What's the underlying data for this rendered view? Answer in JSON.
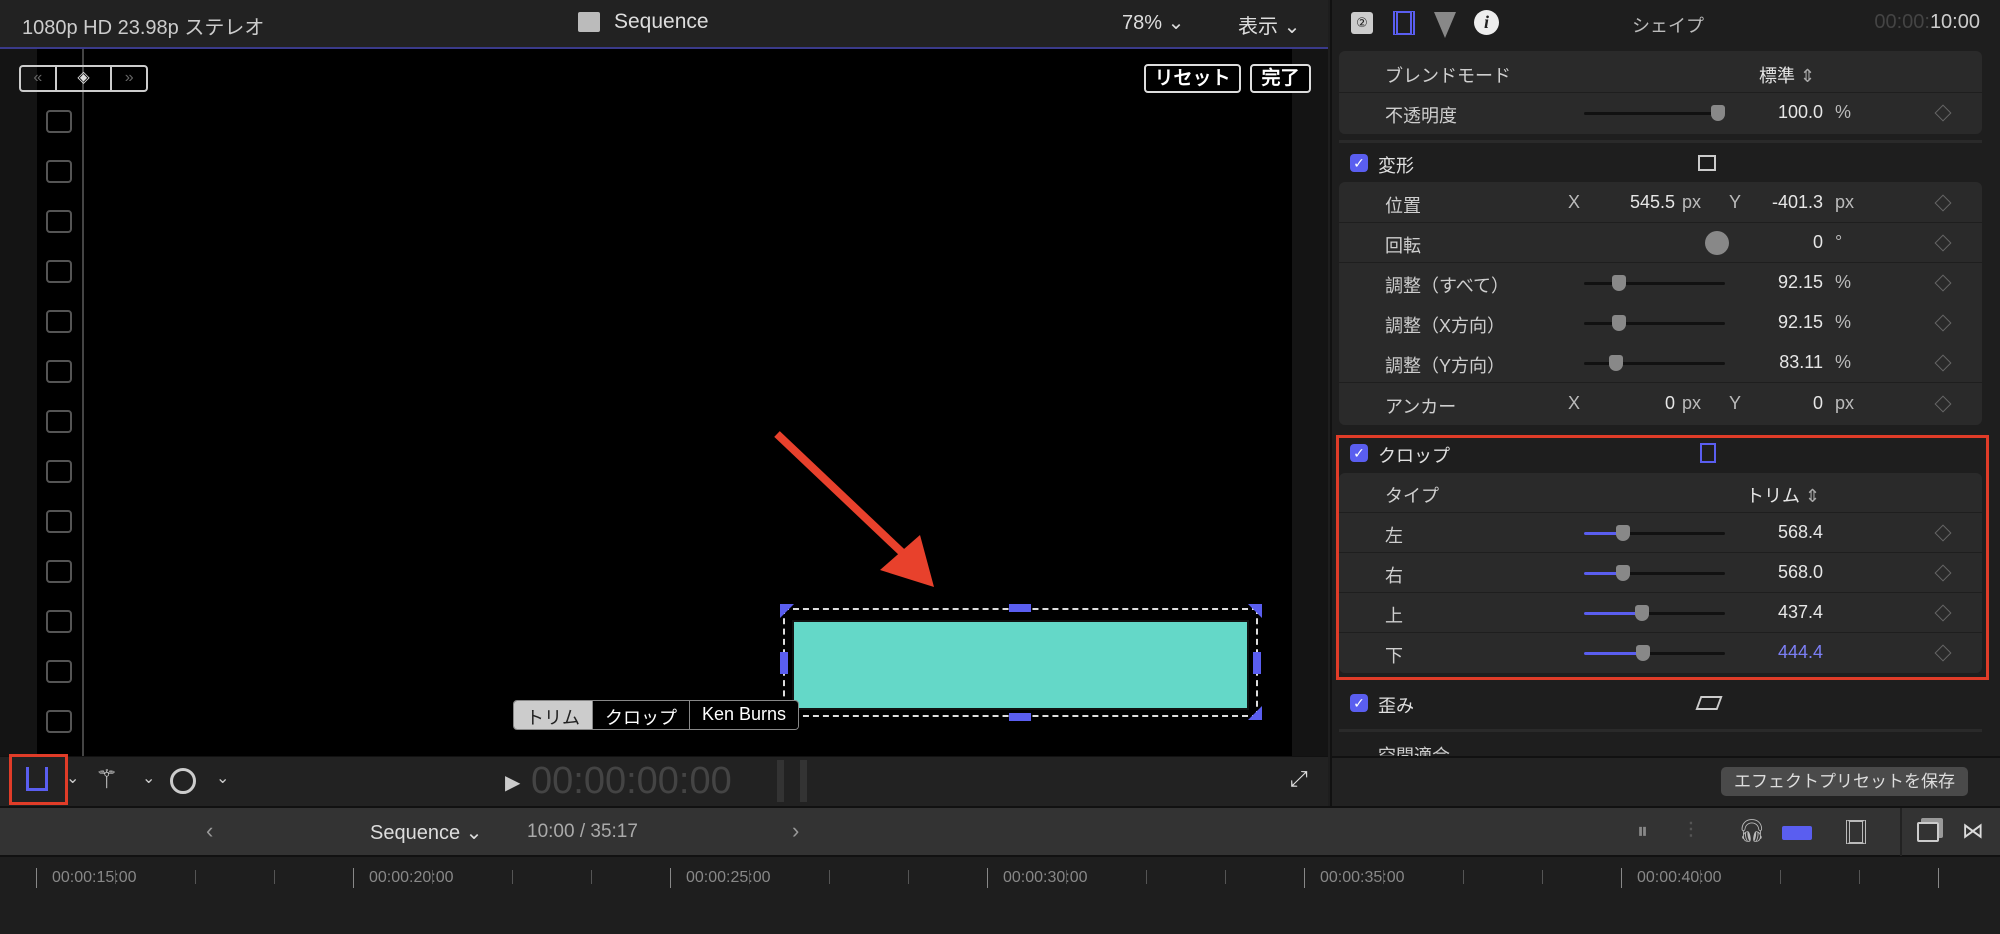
{
  "viewer": {
    "format": "1080p HD 23.98p ステレオ",
    "title": "Sequence",
    "zoom": "78%",
    "view_menu": "表示",
    "reset": "リセット",
    "done": "完了",
    "timecode": "00:00:00:00",
    "checkbox_count": 13,
    "crop_modes": [
      "トリム",
      "クロップ",
      "Ken Burns"
    ],
    "active_crop_mode": "トリム",
    "shape_color": "#64d8c8"
  },
  "inspector": {
    "title": "シェイプ",
    "timecode_dim": "00:00:",
    "timecode": "10:00",
    "blend": {
      "label": "ブレンドモード",
      "value": "標準"
    },
    "opacity": {
      "label": "不透明度",
      "value": "100.0",
      "unit": "%",
      "slider": 1.0
    },
    "transform": {
      "label": "変形",
      "checked": true,
      "position": {
        "label": "位置",
        "x_label": "X",
        "x": "545.5",
        "y_label": "Y",
        "y": "-401.3",
        "unit": "px"
      },
      "rotation": {
        "label": "回転",
        "value": "0",
        "unit": "°"
      },
      "scale_all": {
        "label": "調整（すべて）",
        "value": "92.15",
        "unit": "%",
        "slider": 0.25
      },
      "scale_x": {
        "label": "調整（X方向）",
        "value": "92.15",
        "unit": "%",
        "slider": 0.25
      },
      "scale_y": {
        "label": "調整（Y方向）",
        "value": "83.11",
        "unit": "%",
        "slider": 0.23
      },
      "anchor": {
        "label": "アンカー",
        "x_label": "X",
        "x": "0",
        "y_label": "Y",
        "y": "0",
        "unit": "px"
      }
    },
    "crop": {
      "label": "クロップ",
      "checked": true,
      "type_label": "タイプ",
      "type_value": "トリム",
      "rows": [
        {
          "label": "左",
          "value": "568.4",
          "slider": 0.28
        },
        {
          "label": "右",
          "value": "568.0",
          "slider": 0.28
        },
        {
          "label": "上",
          "value": "437.4",
          "slider": 0.41
        },
        {
          "label": "下",
          "value": "444.4",
          "slider": 0.42
        }
      ]
    },
    "distort": {
      "label": "歪み",
      "checked": true
    },
    "spatial": {
      "label": "空間適合"
    },
    "save_preset": "エフェクトプリセットを保存"
  },
  "timeline": {
    "sequence": "Sequence",
    "position": "10:00 / 35:17",
    "ruler": [
      "00:00:15:00",
      "00:00:20:00",
      "00:00:25:00",
      "00:00:30:00",
      "00:00:35:00",
      "00:00:40:00"
    ]
  },
  "colors": {
    "accent": "#5a5ef0",
    "highlight": "#e03c28"
  }
}
